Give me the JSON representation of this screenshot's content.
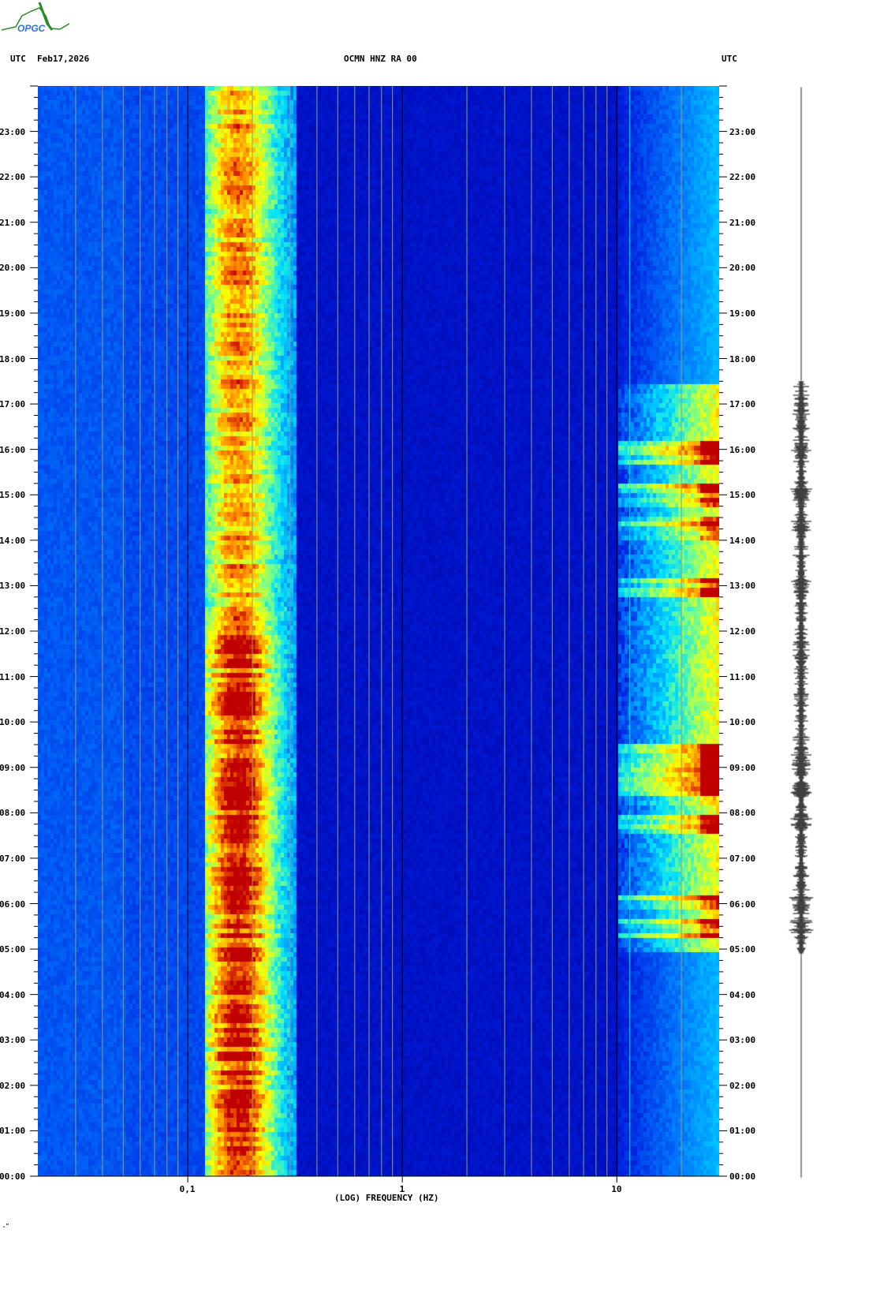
{
  "header": {
    "left_tz": "UTC",
    "date": "Feb17,2026",
    "station": "OCMN HNZ RA 00",
    "right_tz": "UTC"
  },
  "logo": {
    "text": "OPGC"
  },
  "footer_mark": ".\"",
  "chart_data": {
    "type": "heatmap",
    "title": "OCMN HNZ RA 00",
    "xlabel": "(LOG) FREQUENCY (HZ)",
    "xscale": "log",
    "xlim": [
      0.02,
      30
    ],
    "xticks": [
      {
        "value": 0.1,
        "label": "0,1"
      },
      {
        "value": 1,
        "label": "1"
      },
      {
        "value": 10,
        "label": "10"
      }
    ],
    "ylabel": "UTC",
    "ylim": [
      0,
      24
    ],
    "yticks": [
      "00:00",
      "01:00",
      "02:00",
      "03:00",
      "04:00",
      "05:00",
      "06:00",
      "07:00",
      "08:00",
      "09:00",
      "10:00",
      "11:00",
      "12:00",
      "13:00",
      "14:00",
      "15:00",
      "16:00",
      "17:00",
      "18:00",
      "19:00",
      "20:00",
      "21:00",
      "22:00",
      "23:00"
    ],
    "features": {
      "microseism_band_hz": [
        0.12,
        0.35
      ],
      "microseism_peak_hz": 0.17,
      "high_freq_activity_hz": [
        10,
        30
      ],
      "high_freq_active_hours": [
        5,
        17.5
      ],
      "strong_events_hours": [
        5.5,
        6,
        7.8,
        8.5,
        9,
        9.3,
        13,
        14.3,
        15,
        16
      ]
    },
    "colormap": [
      "#0000a0",
      "#0020e0",
      "#0080ff",
      "#00e0ff",
      "#80ff80",
      "#ffff00",
      "#ff8000",
      "#c00000"
    ]
  }
}
